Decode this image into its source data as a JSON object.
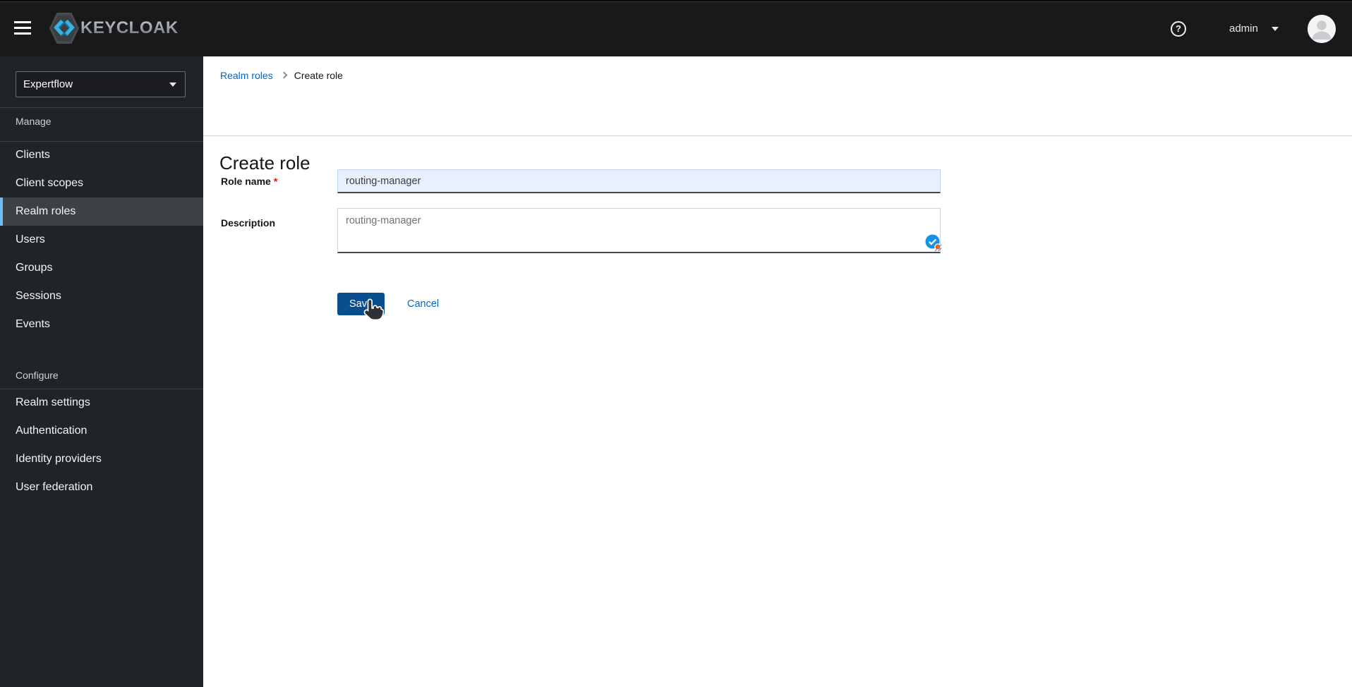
{
  "header": {
    "brand": "KEYCLOAK",
    "help_glyph": "?",
    "username": "admin"
  },
  "sidebar": {
    "realm": "Expertflow",
    "selected_item": "Realm roles",
    "sections": [
      {
        "title": "Manage",
        "items": [
          "Clients",
          "Client scopes",
          "Realm roles",
          "Users",
          "Groups",
          "Sessions",
          "Events"
        ]
      },
      {
        "title": "Configure",
        "items": [
          "Realm settings",
          "Authentication",
          "Identity providers",
          "User federation"
        ]
      }
    ]
  },
  "breadcrumb": {
    "parent": "Realm roles",
    "current": "Create role"
  },
  "page": {
    "title": "Create role"
  },
  "form": {
    "role_name": {
      "label": "Role name",
      "required_mark": "*",
      "value": "routing-manager"
    },
    "description": {
      "label": "Description",
      "value": "routing-manager"
    },
    "save_label": "Save",
    "cancel_label": "Cancel"
  },
  "colors": {
    "header_bg": "#18191b",
    "sidebar_bg": "#212427",
    "nav_selected_bg": "#3d4146",
    "nav_selected_bar": "#73bcf7",
    "link_accent": "#0066cc",
    "save_button": "#0b4e8e",
    "autofill_input_bg": "#e8f0fe",
    "required_mark": "#c9190b"
  },
  "icons": {
    "hamburger-menu-icon": "three horizontal bars",
    "keycloak-logo-icon": "gray hexagon with blue double angle brackets",
    "help-icon": "question mark in circle",
    "caret-down-icon": "▾",
    "avatar-icon": "person silhouette in light circle",
    "breadcrumb-separator-icon": "›",
    "editor-extension-icon": "blue circle with white checkmark and orange dot",
    "textarea-resize-handle": "diagonal grip lines",
    "mouse-cursor": "hand pointer"
  }
}
